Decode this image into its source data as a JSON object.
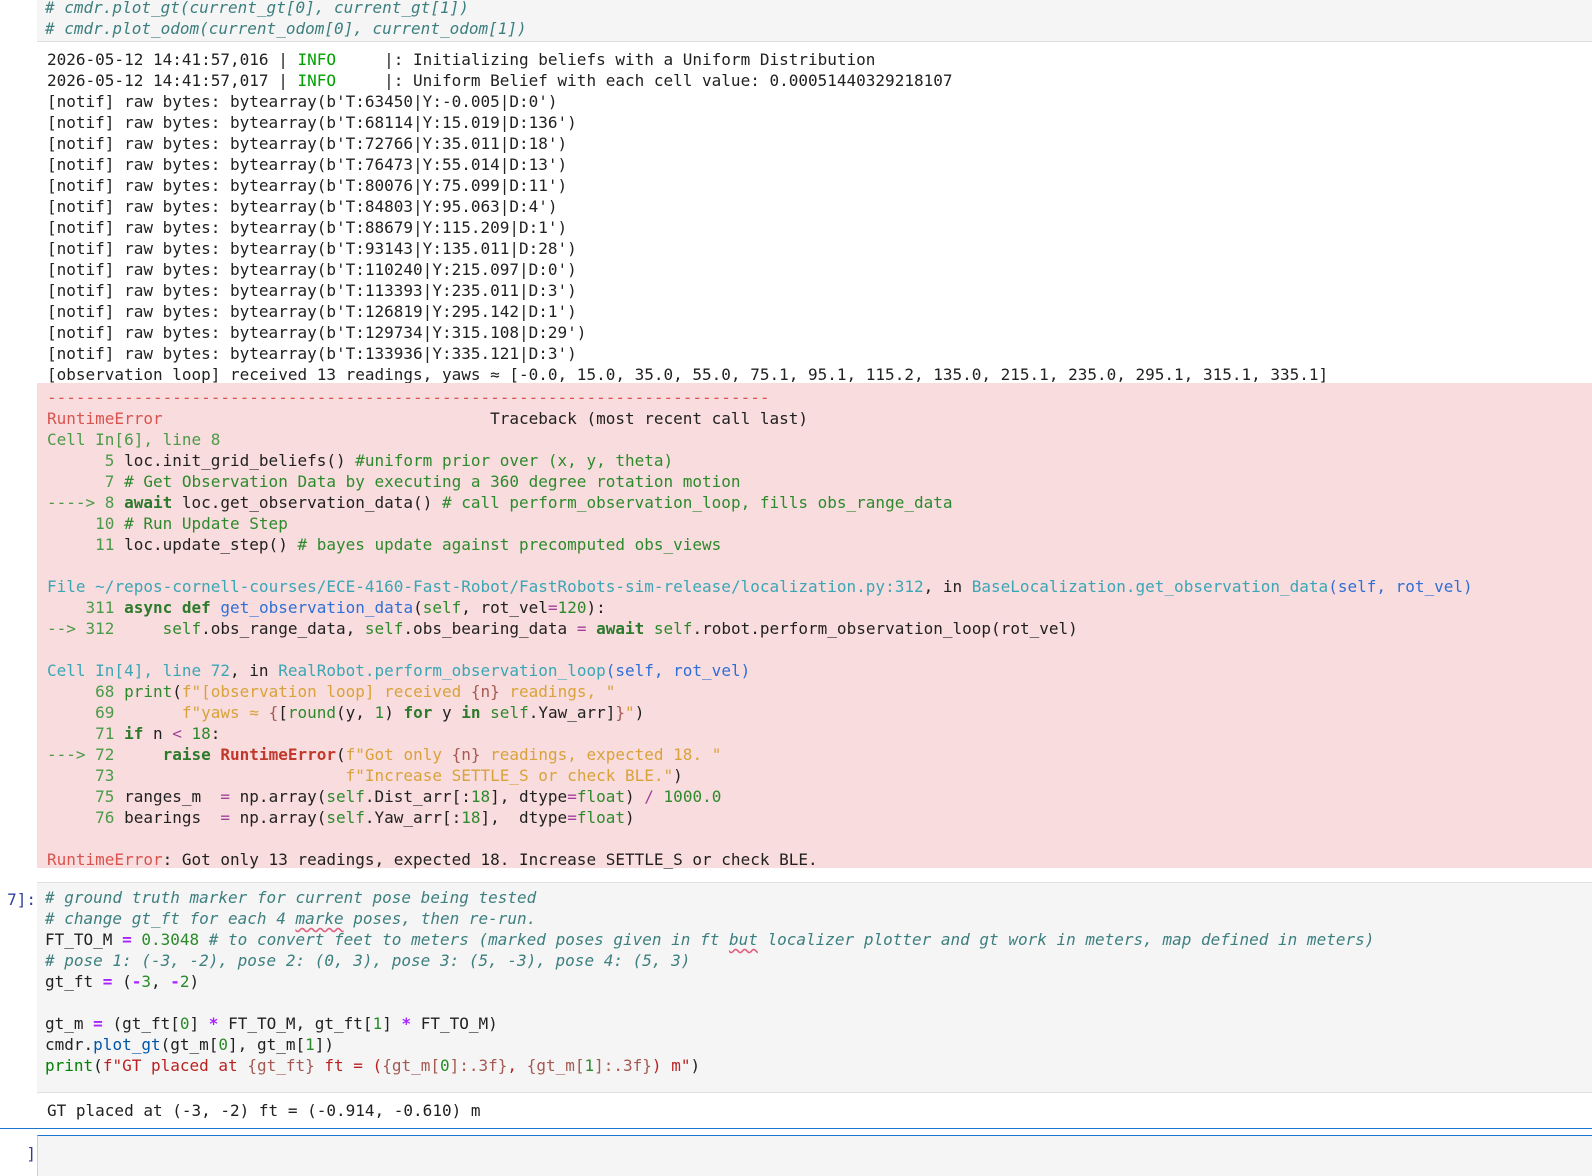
{
  "top_cell": {
    "line1": "# cmdr.plot_gt(current_gt[0], current_gt[1])",
    "line2": "# cmdr.plot_odom(current_odom[0], current_odom[1])"
  },
  "log": {
    "line1_ts": "2026-05-12 14:41:57,016 | ",
    "line1_level": "INFO",
    "line1_msg": "     |: Initializing beliefs with a Uniform Distribution",
    "line2_ts": "2026-05-12 14:41:57,017 | ",
    "line2_level": "INFO",
    "line2_msg": "     |: Uniform Belief with each cell value: 0.00051440329218107",
    "notif": [
      "[notif] raw bytes: bytearray(b'T:63450|Y:-0.005|D:0')",
      "[notif] raw bytes: bytearray(b'T:68114|Y:15.019|D:136')",
      "[notif] raw bytes: bytearray(b'T:72766|Y:35.011|D:18')",
      "[notif] raw bytes: bytearray(b'T:76473|Y:55.014|D:13')",
      "[notif] raw bytes: bytearray(b'T:80076|Y:75.099|D:11')",
      "[notif] raw bytes: bytearray(b'T:84803|Y:95.063|D:4')",
      "[notif] raw bytes: bytearray(b'T:88679|Y:115.209|D:1')",
      "[notif] raw bytes: bytearray(b'T:93143|Y:135.011|D:28')",
      "[notif] raw bytes: bytearray(b'T:110240|Y:215.097|D:0')",
      "[notif] raw bytes: bytearray(b'T:113393|Y:235.011|D:3')",
      "[notif] raw bytes: bytearray(b'T:126819|Y:295.142|D:1')",
      "[notif] raw bytes: bytearray(b'T:129734|Y:315.108|D:29')",
      "[notif] raw bytes: bytearray(b'T:133936|Y:335.121|D:3')"
    ],
    "summary": "[observation loop] received 13 readings, yaws ≈ [-0.0, 15.0, 35.0, 55.0, 75.1, 95.1, 115.2, 135.0, 215.1, 235.0, 295.1, 315.1, 335.1]"
  },
  "traceback": {
    "dashes": "---------------------------------------------------------------------------",
    "error_name": "RuntimeError",
    "header_right": "                                  Traceback (most recent call last)",
    "cell6": "Cell In[6], line 8",
    "c6_l5_no": "      5 ",
    "c6_l5_code": "loc.init_grid_beliefs() ",
    "c6_l5_cm": "#uniform prior over (x, y, theta)",
    "c6_l7_no": "      7 ",
    "c6_l7_cm": "# Get Observation Data by executing a 360 degree rotation motion",
    "c6_l8_arrow": "----> 8 ",
    "c6_l8_kw": "await",
    "c6_l8_code": " loc.get_observation_data() ",
    "c6_l8_cm": "# call perform_observation_loop, fills obs_range_data",
    "c6_l10_no": "     10 ",
    "c6_l10_cm": "# Run Update Step",
    "c6_l11_no": "     11 ",
    "c6_l11_code": "loc.update_step() ",
    "c6_l11_cm": "# bayes update against precomputed obs_views",
    "file_prefix": "File ",
    "file_path": "~/repos-cornell-courses/ECE-4160-Fast-Robot/FastRobots-sim-release/localization.py:312",
    "file_in": ", in ",
    "file_func": "BaseLocalization.get_observation_data",
    "file_args": "(self, rot_vel)",
    "f_l311_no": "    311 ",
    "f_l311_kw1": "async",
    "f_l311_kw2": "def",
    "f_l311_fn": "get_observation_data",
    "f_l311_rest1": "(",
    "f_l311_self": "self",
    "f_l311_rest2": ", rot_vel",
    "f_l311_eq": "=",
    "f_l311_num": "120",
    "f_l311_rest3": "):",
    "f_l312_arrow": "--> 312 ",
    "f_l312_self1": "self",
    "f_l312_mid1": ".obs_range_data, ",
    "f_l312_self2": "self",
    "f_l312_mid2": ".obs_bearing_data ",
    "f_l312_eq": "=",
    "f_l312_kw": "await",
    "f_l312_self3": "self",
    "f_l312_rest": ".robot.perform_observation_loop(rot_vel)",
    "cell4": "Cell In[4], line 72",
    "cell4_in": ", in ",
    "cell4_func": "RealRobot.perform_observation_loop",
    "cell4_args": "(self, rot_vel)",
    "c4_l68_no": "     68 ",
    "c4_l68_bi": "print",
    "c4_l68_p": "(",
    "c4_l68_s1": "f\"[observation loop] received ",
    "c4_l68_b1": "{n}",
    "c4_l68_s2": " readings, \"",
    "c4_l69_no": "     69 ",
    "c4_l69_s1": "f\"yaws ≈ ",
    "c4_l69_b1": "{",
    "c4_l69_code1": "[",
    "c4_l69_bi": "round",
    "c4_l69_code2": "(y, ",
    "c4_l69_num": "1",
    "c4_l69_code3": ") ",
    "c4_l69_kw1": "for",
    "c4_l69_code4": " y ",
    "c4_l69_kw2": "in",
    "c4_l69_self": "self",
    "c4_l69_code5": ".Yaw_arr]",
    "c4_l69_b2": "}",
    "c4_l69_s2": "\"",
    "c4_l69_end": ")",
    "c4_l71_no": "     71 ",
    "c4_l71_kw": "if",
    "c4_l71_code": " n ",
    "c4_l71_op": "<",
    "c4_l71_num": "18",
    "c4_l71_end": ":",
    "c4_l72_arrow": "---> 72 ",
    "c4_l72_kw": "raise",
    "c4_l72_err": "RuntimeError",
    "c4_l72_p": "(",
    "c4_l72_s1": "f\"Got only ",
    "c4_l72_b": "{n}",
    "c4_l72_s2": " readings, expected 18. \"",
    "c4_l73_no": "     73 ",
    "c4_l73_s": "f\"Increase SETTLE_S or check BLE.\"",
    "c4_l73_end": ")",
    "c4_l75_no": "     75 ",
    "c4_l75_code1": "ranges_m  ",
    "c4_l75_eq": "=",
    "c4_l75_code2": " np.array(",
    "c4_l75_self": "self",
    "c4_l75_code3": ".Dist_arr[:",
    "c4_l75_num": "18",
    "c4_l75_code4": "], dtype",
    "c4_l75_eq2": "=",
    "c4_l75_bi": "float",
    "c4_l75_code5": ") ",
    "c4_l75_op": "/",
    "c4_l75_num2": "1000.0",
    "c4_l76_no": "     76 ",
    "c4_l76_code1": "bearings  ",
    "c4_l76_eq": "=",
    "c4_l76_code2": " np.array(",
    "c4_l76_self": "self",
    "c4_l76_code3": ".Yaw_arr[:",
    "c4_l76_num": "18",
    "c4_l76_code4": "],  dtype",
    "c4_l76_eq2": "=",
    "c4_l76_bi": "float",
    "c4_l76_code5": ")",
    "final_name": "RuntimeError",
    "final_msg": ": Got only 13 readings, expected 18. Increase SETTLE_S or check BLE."
  },
  "cell7": {
    "prompt": "7]:",
    "l1": "# ground truth marker for current pose being tested",
    "l2a": "# change gt_ft for each 4 ",
    "l2b": "marke",
    "l2c": " poses, then re-run.",
    "l3_var": "FT_TO_M ",
    "l3_eq": "=",
    "l3_num": "0.3048",
    "l3_cm1": "# to convert feet to meters (marked poses given in ft ",
    "l3_cm2": "but",
    "l3_cm3": " localizer plotter and gt work in meters, map defined in meters)",
    "l4": "# pose 1: (-3, -2), pose 2: (0, 3), pose 3: (5, -3), pose 4: (5, 3)",
    "l5_var": "gt_ft ",
    "l5_eq": "=",
    "l5_p1": "(",
    "l5_minus1": "-",
    "l5_n1": "3",
    "l5_c": ", ",
    "l5_minus2": "-",
    "l5_n2": "2",
    "l5_p2": ")",
    "l7_var": "gt_m ",
    "l7_eq": "=",
    "l7_a": "(gt_ft[",
    "l7_n0": "0",
    "l7_b": "] ",
    "l7_mul1": "*",
    "l7_c": " FT_TO_M, gt_ft[",
    "l7_n1": "1",
    "l7_d": "] ",
    "l7_mul2": "*",
    "l7_e": " FT_TO_M)",
    "l8_a": "cmdr.",
    "l8_fn": "plot_gt",
    "l8_b": "(gt_m[",
    "l8_n0": "0",
    "l8_c": "], gt_m[",
    "l8_n1": "1",
    "l8_d": "])",
    "l9_bi": "print",
    "l9_p": "(",
    "l9_s1": "f\"GT placed at ",
    "l9_i1": "{gt_ft}",
    "l9_s2": " ft = (",
    "l9_i2a": "{gt_m[",
    "l9_i2n": "0",
    "l9_i2b": "]:.3f}",
    "l9_s3": ", ",
    "l9_i3a": "{gt_m[",
    "l9_i3n": "1",
    "l9_i3b": "]:.3f}",
    "l9_s4": ") m\"",
    "l9_end": ")",
    "output": "GT placed at (-3, -2) ft = (-0.914, -0.610) m"
  },
  "bottom_prompt": "]"
}
